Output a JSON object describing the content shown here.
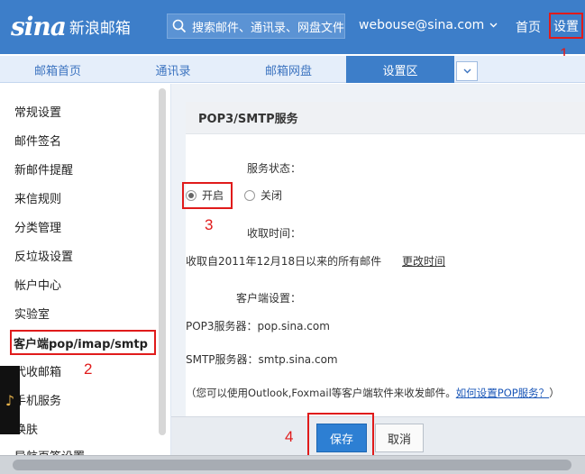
{
  "header": {
    "logo_mark": "sina",
    "logo_text": "新浪邮箱",
    "search_placeholder": "搜索邮件、通讯录、网盘文件",
    "user_email": "webouse@sina.com",
    "nav_home": "首页",
    "nav_settings": "设置"
  },
  "tabs": [
    {
      "label": "邮箱首页"
    },
    {
      "label": "通讯录"
    },
    {
      "label": "邮箱网盘"
    },
    {
      "label": "设置区"
    }
  ],
  "sidebar": {
    "items": [
      {
        "label": "常规设置"
      },
      {
        "label": "邮件签名"
      },
      {
        "label": "新邮件提醒"
      },
      {
        "label": "来信规则"
      },
      {
        "label": "分类管理"
      },
      {
        "label": "反垃圾设置"
      },
      {
        "label": "帐户中心"
      },
      {
        "label": "实验室"
      },
      {
        "label": "客户端pop/imap/smtp"
      },
      {
        "label": "代收邮箱"
      },
      {
        "label": "手机服务"
      },
      {
        "label": "换肤"
      },
      {
        "label": "导航页签设置"
      }
    ]
  },
  "panel": {
    "title": "POP3/SMTP服务",
    "service_status_label": "服务状态：",
    "radio_on": "开启",
    "radio_off": "关闭",
    "receive_time_label": "收取时间：",
    "receive_time_text": "收取自2011年12月18日以来的所有邮件",
    "change_time_link": "更改时间",
    "client_settings_label": "客户端设置：",
    "pop3_server": "POP3服务器：pop.sina.com",
    "smtp_server": "SMTP服务器：smtp.sina.com",
    "note_text": "（您可以使用Outlook,Foxmail等客户端软件来收发邮件。",
    "note_link": "如何设置POP服务？",
    "note_close": "）"
  },
  "buttons": {
    "save": "保存",
    "cancel": "取消"
  },
  "annotations": [
    "1",
    "2",
    "3",
    "4"
  ],
  "colors": {
    "brand_blue": "#3d7ec9",
    "annotation_red": "#e01b1b",
    "link_blue": "#1b57b8"
  },
  "icons": {
    "search": "search-icon",
    "dropdown": "chevron-down-icon",
    "music": "music-note-icon"
  }
}
